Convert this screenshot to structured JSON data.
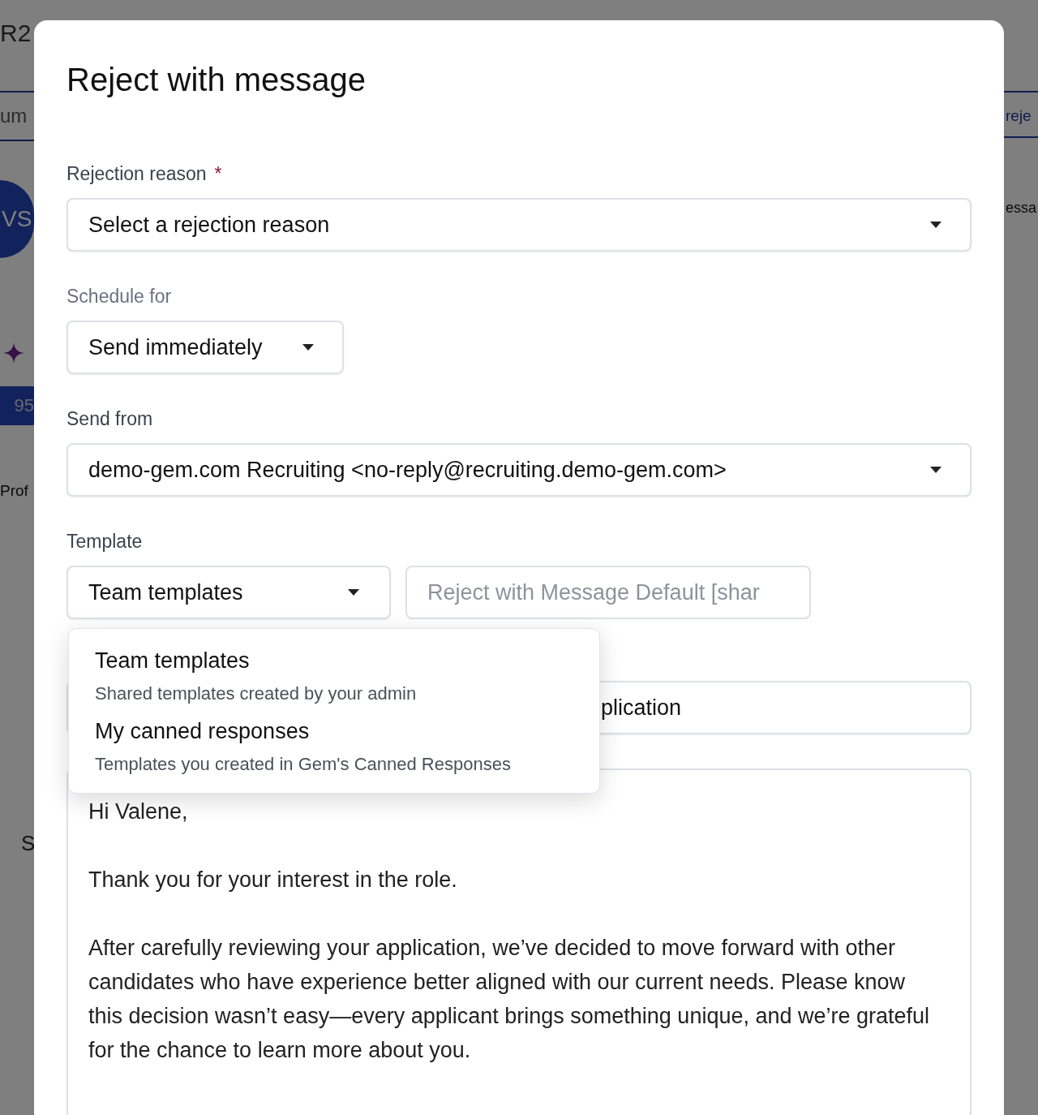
{
  "background": {
    "page_title": "R2",
    "tab_left": "um",
    "avatar": "VS",
    "score": "95",
    "section_title": "Prof",
    "label": "S",
    "tab_right": "reje",
    "heading_right": "essa"
  },
  "modal": {
    "title": "Reject with message",
    "rejection_reason": {
      "label": "Rejection reason",
      "required_mark": "*",
      "value": "Select a rejection reason"
    },
    "schedule": {
      "label": "Schedule for",
      "value": "Send immediately"
    },
    "send_from": {
      "label": "Send from",
      "value": "demo-gem.com Recruiting <no-reply@recruiting.demo-gem.com>"
    },
    "template": {
      "label": "Template",
      "category": "Team templates",
      "template_name": "Reject with Message Default [shar",
      "disabled": true
    },
    "template_menu": [
      {
        "title": "Team templates",
        "description": "Shared templates created by your admin"
      },
      {
        "title": "My canned responses",
        "description": "Templates you created in Gem's Canned Responses"
      }
    ],
    "subject": {
      "value": "plication"
    },
    "body": [
      "Hi Valene,",
      "Thank you for your interest in the role.",
      "After carefully reviewing your application, we’ve decided to move forward with other candidates who have experience better aligned with our current needs. Please know this decision wasn’t easy—every applicant brings something unique, and we’re grateful for the chance to learn more about you."
    ]
  }
}
